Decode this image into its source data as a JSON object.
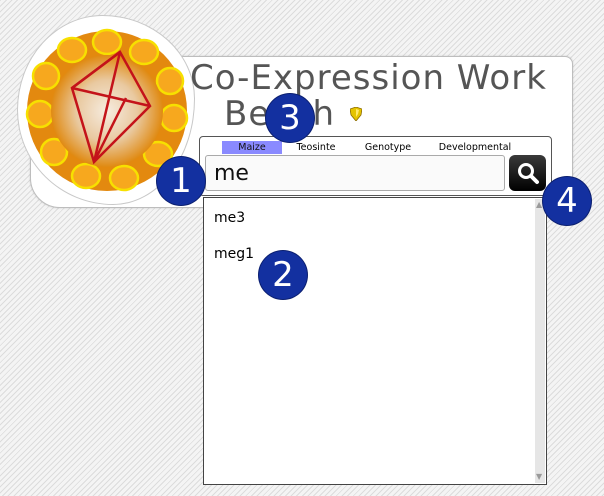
{
  "app": {
    "title_line1": "Co-Expression Work",
    "title_line2": "Bench"
  },
  "tabs": [
    {
      "label": "Maize",
      "active": true
    },
    {
      "label": "Teosinte",
      "active": false
    },
    {
      "label": "Genotype",
      "active": false
    },
    {
      "label": "Developmental",
      "active": false
    }
  ],
  "search": {
    "value": "me",
    "button_icon": "magnifier-icon"
  },
  "suggestions": [
    "me3",
    "meg1"
  ],
  "callouts": [
    "1",
    "2",
    "3",
    "4"
  ],
  "colors": {
    "callout": "#1330a0",
    "active_tab": "#8a8aff",
    "logo_network": "#c4131a"
  }
}
